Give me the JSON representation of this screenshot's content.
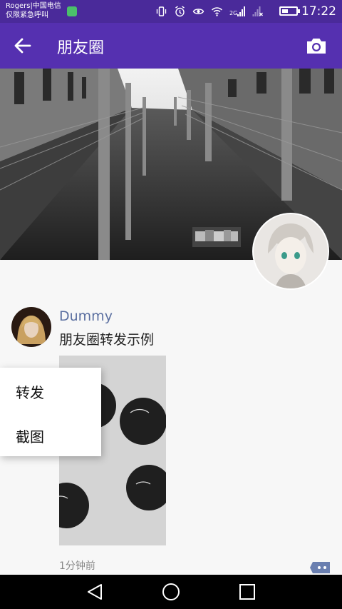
{
  "status_bar": {
    "carrier_line1": "Rogers|中国电信",
    "carrier_line2": "仅限紧急呼叫",
    "network_label": "2G",
    "time": "17:22"
  },
  "app_bar": {
    "title": "朋友圈",
    "back_icon": "arrow-left-icon",
    "camera_icon": "camera-icon"
  },
  "post": {
    "author": "Dummy",
    "text": "朋友圈转发示例",
    "time": "1分钟前"
  },
  "context_menu": {
    "items": [
      "转发",
      "截图"
    ]
  },
  "colors": {
    "status_bar": "#4a2a9a",
    "app_bar": "#5530b0",
    "author_name": "#5b6fa0",
    "background": "#f7f7f7"
  }
}
